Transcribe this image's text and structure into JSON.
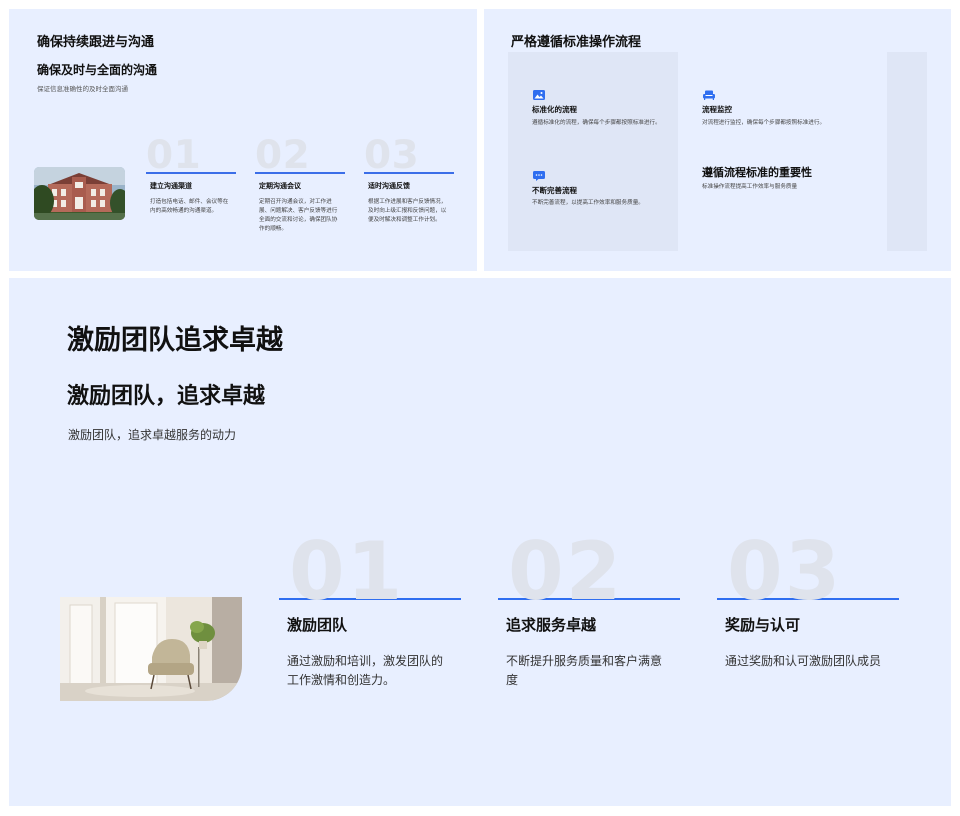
{
  "slide1": {
    "title": "确保持续跟进与沟通",
    "subtitle": "确保及时与全面的沟通",
    "description": "保证信息准确性的及时全面沟通",
    "steps": [
      {
        "num": "01",
        "title": "建立沟通渠道",
        "text": "打造包括电话、邮件、会议等在内的高效畅通的沟通渠道。"
      },
      {
        "num": "02",
        "title": "定期沟通会议",
        "text": "定期召开沟通会议，对工作进展、问题解决、客户反馈等进行全面的交流和讨论，确保团队协作的顺畅。"
      },
      {
        "num": "03",
        "title": "适时沟通反馈",
        "text": "根据工作进展和客户反馈情况，及时向上级汇报和反馈问题，以便及时解决和调整工作计划。"
      }
    ]
  },
  "slide2": {
    "title": "严格遵循标准操作流程",
    "items": [
      {
        "icon": "image-icon",
        "title": "标准化的流程",
        "text": "遵循标准化的流程，确保每个步骤都按照标准进行。"
      },
      {
        "icon": "chat-icon",
        "title": "不断完善流程",
        "text": "不断完善流程，以提高工作效率和服务质量。"
      },
      {
        "icon": "sofa-icon",
        "title": "流程监控",
        "text": "对流程进行监控，确保每个步骤都按照标准进行。"
      }
    ],
    "highlight": {
      "title": "遵循流程标准的重要性",
      "text": "标准操作流程提高工作效率与服务质量"
    },
    "accent_color": "#2f6ef0"
  },
  "slide3": {
    "title": "激励团队追求卓越",
    "subtitle": "激励团队，追求卓越",
    "description": "激励团队，追求卓越服务的动力",
    "steps": [
      {
        "num": "01",
        "title": "激励团队",
        "text": "通过激励和培训，激发团队的工作激情和创造力。"
      },
      {
        "num": "02",
        "title": "追求服务卓越",
        "text": "不断提升服务质量和客户满意度"
      },
      {
        "num": "03",
        "title": "奖励与认可",
        "text": "通过奖励和认可激励团队成员"
      }
    ]
  }
}
